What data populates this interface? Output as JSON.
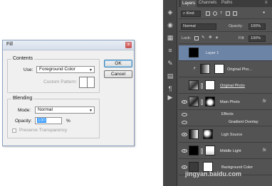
{
  "dialog": {
    "title": "Fill",
    "close_glyph": "x",
    "contents_legend": "Contents",
    "use_label": "Use:",
    "use_value": "Foreground Color",
    "custom_pattern_label": "Custom Pattern:",
    "blending_legend": "Blending",
    "mode_label": "Mode:",
    "mode_value": "Normal",
    "opacity_label": "Opacity:",
    "opacity_value": "100",
    "opacity_unit": "%",
    "preserve_label": "Preserve Transparency",
    "ok_label": "OK",
    "cancel_label": "Cancel"
  },
  "layers_panel": {
    "tabs": [
      "Layers",
      "Channels",
      "Paths"
    ],
    "filter_label": "Kind",
    "blend_mode": "Normal",
    "opacity_label": "Opacity:",
    "opacity_value": "100%",
    "lock_label": "Lock:",
    "fill_label": "Fill:",
    "fill_value": "100%",
    "layers": [
      {
        "name": "Layer 1",
        "selected": true
      },
      {
        "name": "Original Pho..."
      },
      {
        "name": "Original Photo"
      },
      {
        "name": "Main Photo",
        "fx": "fx"
      },
      {
        "name": "Effects"
      },
      {
        "name": "Gradient Overlay"
      },
      {
        "name": "Ligh Source"
      },
      {
        "name": "Middle Light",
        "fx": "fx"
      },
      {
        "name": "Background Color"
      }
    ]
  },
  "watermark": "jingyan.baidu.com"
}
